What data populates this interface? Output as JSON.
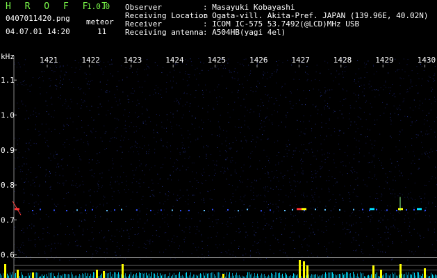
{
  "app": {
    "title": "H R O F F T",
    "version": "1.0.0",
    "filename": "0407011420.png",
    "datetime": "04.07.01 14:20",
    "count_label": "meteor",
    "count_value": "11"
  },
  "info": [
    {
      "label": "Observer",
      "value": ": Masayuki Kobayashi"
    },
    {
      "label": "Receiving Location",
      "value": ": Ogata-vill. Akita-Pref. JAPAN (139.96E, 40.02N)"
    },
    {
      "label": "Receiver",
      "value": ": ICOM IC-575 53.7492(@LCD)MHz USB"
    },
    {
      "label": "Receiving antenna",
      "value": ": A504HB(yagi 4el)"
    }
  ],
  "chart_data": {
    "type": "heatmap",
    "x_axis_label": "",
    "x_ticks": [
      "1421",
      "1422",
      "1423",
      "1424",
      "1425",
      "1426",
      "1427",
      "1428",
      "1429",
      "1430"
    ],
    "y_axis_label": "kHz",
    "y_ticks": [
      "1.1",
      "1.0",
      "0.9",
      "0.8",
      "0.7",
      "0.6"
    ],
    "ylim": [
      0.58,
      1.17
    ],
    "carrier_khz": 0.73,
    "colors": {
      "background": "#000000",
      "noise": "#141a55",
      "axis_text": "#ffffff",
      "echo": "#ffff00",
      "echo_hot": "#ff3030",
      "echo_cool": "#00e0ff"
    }
  }
}
